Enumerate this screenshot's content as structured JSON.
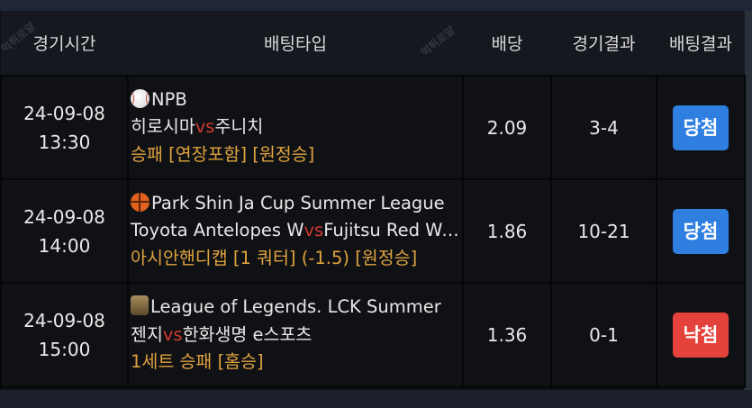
{
  "header": {
    "game_time": "경기시간",
    "bet_type": "배팅타입",
    "odds": "배당",
    "game_result": "경기결과",
    "bet_result": "배팅결과"
  },
  "watermark": "먹튀로얄",
  "rows": [
    {
      "date": "24-09-08",
      "time": "13:30",
      "sport_icon": "baseball-icon",
      "league": "NPB",
      "home": "히로시마",
      "vs": "vs",
      "away": "주니치",
      "market": "승패 [연장포함] [원정승]",
      "odds": "2.09",
      "score": "3-4",
      "result": "당첨",
      "result_color": "#2f7fe0"
    },
    {
      "date": "24-09-08",
      "time": "14:00",
      "sport_icon": "basketball-icon",
      "league": "Park Shin Ja Cup Summer League",
      "home": "Toyota Antelopes W",
      "vs": "vs",
      "away": "Fujitsu Red Wave W",
      "market": "아시안핸디캡 [1 쿼터] (-1.5) [원정승]",
      "odds": "1.86",
      "score": "10-21",
      "result": "당첨",
      "result_color": "#2f7fe0"
    },
    {
      "date": "24-09-08",
      "time": "15:00",
      "sport_icon": "league-of-legends-icon",
      "league": "League of Legends. LCK Summer",
      "home": "젠지",
      "vs": "vs",
      "away": "한화생명 e스포츠",
      "market": "1세트 승패 [홈승]",
      "odds": "1.36",
      "score": "0-1",
      "result": "낙첨",
      "result_color": "#e3433a"
    }
  ]
}
